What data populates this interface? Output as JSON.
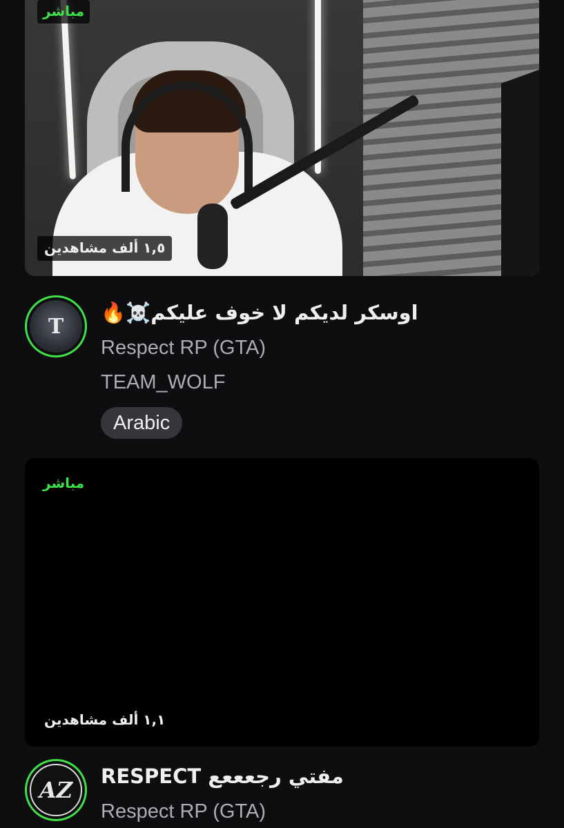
{
  "streams": [
    {
      "live_label": "مباشر",
      "viewers": "١,٥ ألف مشاهدين",
      "title": "اوسكر لديكم لا خوف عليكم☠️🔥",
      "category": "Respect RP (GTA)",
      "streamer": "TEAM_WOLF",
      "tags": [
        "Arabic"
      ],
      "avatar_icon": "team-wolf-logo-icon",
      "avatar_letter": "T"
    },
    {
      "live_label": "مباشر",
      "viewers": "١,١ ألف مشاهدين",
      "title": "مفتي رجعععع RESPECT",
      "category": "Respect RP (GTA)",
      "avatar_icon": "az-logo-icon",
      "avatar_letter": "AZ"
    }
  ],
  "colors": {
    "background": "#0e0e10",
    "live_green": "#3fe04a",
    "text_primary": "#efeff1",
    "text_secondary": "#adadb8",
    "tag_bg": "#35353b"
  }
}
